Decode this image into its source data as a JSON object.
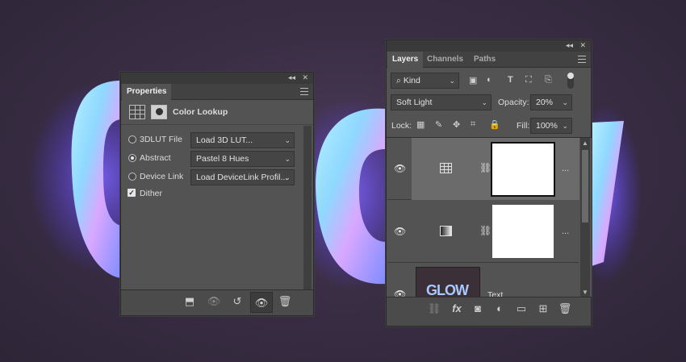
{
  "properties": {
    "title": "Properties",
    "adjustment_name": "Color Lookup",
    "options": [
      {
        "label": "3DLUT File",
        "value": "Load 3D LUT...",
        "selected": false
      },
      {
        "label": "Abstract",
        "value": "Pastel 8 Hues",
        "selected": true
      },
      {
        "label": "Device Link",
        "value": "Load DeviceLink Profil...",
        "selected": false
      }
    ],
    "dither_label": "Dither",
    "dither_checked": true
  },
  "layers": {
    "tabs": [
      "Layers",
      "Channels",
      "Paths"
    ],
    "active_tab": "Layers",
    "filter_label": "Kind",
    "blend_mode": "Soft Light",
    "opacity_label": "Opacity:",
    "opacity_value": "20%",
    "lock_label": "Lock:",
    "fill_label": "Fill:",
    "fill_value": "100%",
    "items": [
      {
        "name": "",
        "type": "color-lookup-adjustment",
        "selected": true
      },
      {
        "name": "",
        "type": "gradient-map-adjustment",
        "selected": false
      },
      {
        "name": "Text",
        "type": "smart-object",
        "thumb_text": "GLOW",
        "selected": false
      }
    ],
    "more_label": "..."
  },
  "artwork": {
    "text": "GLOW"
  },
  "colors": {
    "panel_bg": "#535353",
    "panel_dark": "#424242",
    "selected_row": "#6a6a6a",
    "canvas_bg": "#3a2e45"
  }
}
